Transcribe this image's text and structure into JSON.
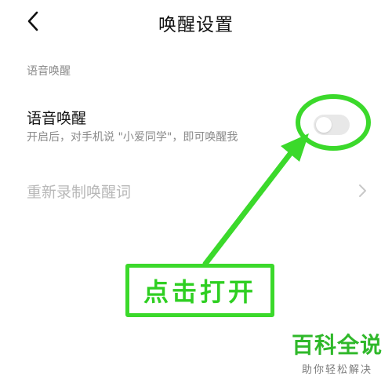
{
  "header": {
    "back_icon": "chevron-left-icon",
    "title": "唤醒设置"
  },
  "section": {
    "label": "语音唤醒"
  },
  "voice_wake": {
    "title": "语音唤醒",
    "subtitle": "开启后，对手机说 \"小爱同学\"，即可唤醒我",
    "toggle_state": "off"
  },
  "rerecord": {
    "label": "重新录制唤醒词",
    "chevron_icon": "chevron-right-icon"
  },
  "annotation": {
    "callout_text": "点击打开",
    "color": "#3bd92b"
  },
  "watermark": {
    "title": "百科全说",
    "subtitle": "助你轻松解决"
  }
}
